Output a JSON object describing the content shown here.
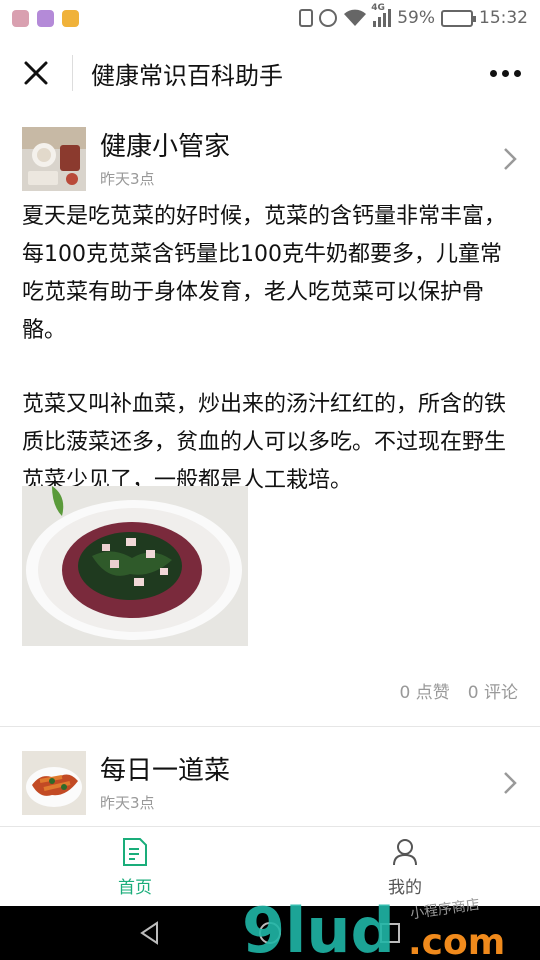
{
  "status_bar": {
    "battery": "59%",
    "battery_level": 0.59,
    "time": "15:32",
    "network": "4G",
    "icons": [
      "vibrate-icon",
      "alarm-icon",
      "wifi-icon",
      "signal-icon",
      "battery-icon"
    ]
  },
  "header": {
    "title": "健康常识百科助手"
  },
  "post": {
    "author": "健康小管家",
    "time": "昨天3点",
    "paragraphs": [
      "夏天是吃苋菜的好时候，苋菜的含钙量非常丰富，每100克苋菜含钙量比100克牛奶都要多，儿童常吃苋菜有助于身体发育，老人吃苋菜可以保护骨骼。",
      "苋菜又叫补血菜，炒出来的汤汁红红的，所含的铁质比菠菜还多，贫血的人可以多吃。不过现在野生苋菜少见了，一般都是人工栽培。"
    ],
    "likes": "0 点赞",
    "comments": "0 评论"
  },
  "next_post": {
    "author": "每日一道菜",
    "time": "昨天3点"
  },
  "tabs": [
    {
      "label": "首页",
      "icon": "document-icon",
      "active": true
    },
    {
      "label": "我的",
      "icon": "user-icon",
      "active": false
    }
  ],
  "watermark": {
    "text": "9lud.com",
    "small_text": "小程序商店"
  },
  "colors": {
    "accent": "#1aad7a",
    "watermark_teal": "#1fb6a6",
    "watermark_orange": "#f08a1c"
  }
}
